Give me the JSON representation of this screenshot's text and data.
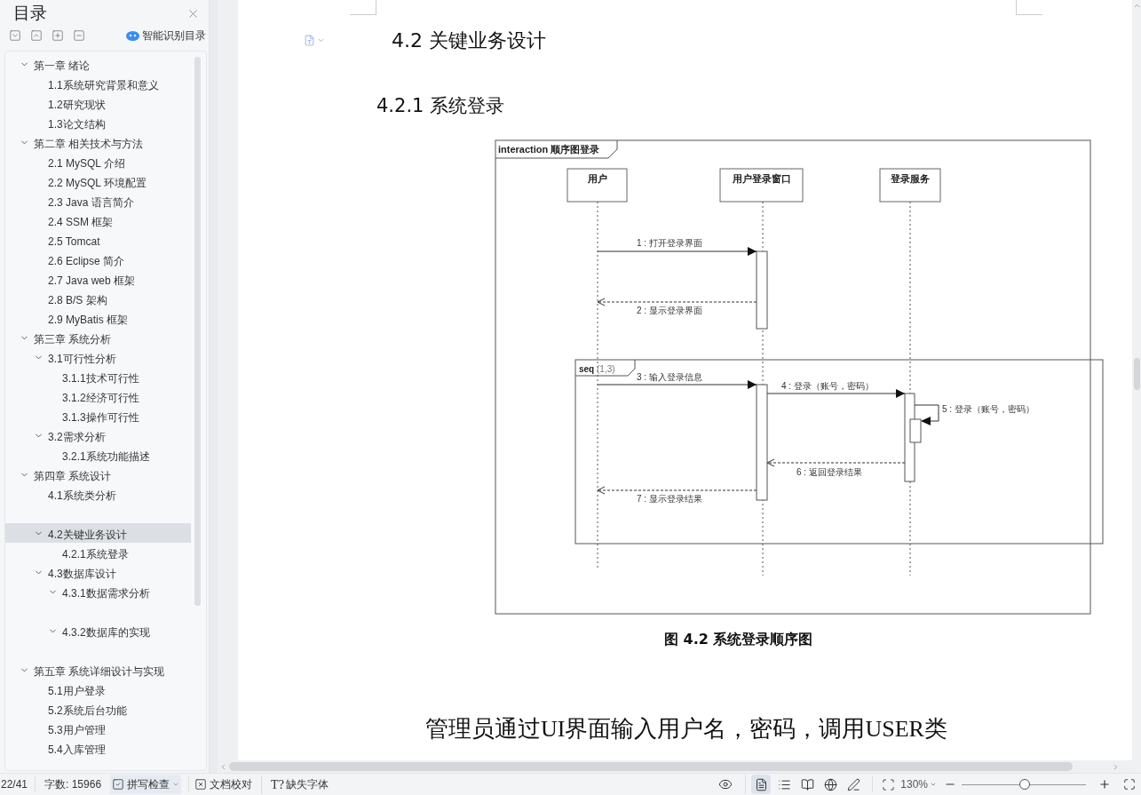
{
  "sidebar": {
    "title": "目录",
    "smart_button": "智能识别目录",
    "items": [
      {
        "label": "第一章  绪论",
        "expanded": true,
        "selected": false,
        "children": [
          {
            "label": "1.1系统研究背景和意义",
            "selected": false
          },
          {
            "label": "1.2研究现状",
            "selected": false
          },
          {
            "label": "1.3论文结构",
            "selected": false
          }
        ]
      },
      {
        "label": "第二章  相关技术与方法",
        "expanded": true,
        "selected": false,
        "children": [
          {
            "label": "2.1 MySQL  介绍",
            "selected": false
          },
          {
            "label": "2.2 MySQL 环境配置",
            "selected": false
          },
          {
            "label": "2.3 Java 语言简介",
            "selected": false
          },
          {
            "label": "2.4 SSM 框架",
            "selected": false
          },
          {
            "label": "2.5 Tomcat",
            "selected": false
          },
          {
            "label": "2.6 Eclipse 简介",
            "selected": false
          },
          {
            "label": "2.7 Java web 框架",
            "selected": false
          },
          {
            "label": "2.8 B/S 架构",
            "selected": false
          },
          {
            "label": "2.9 MyBatis 框架",
            "selected": false
          }
        ]
      },
      {
        "label": "第三章  系统分析",
        "expanded": true,
        "selected": false,
        "children": [
          {
            "label": "3.1可行性分析",
            "expanded": true,
            "selected": false,
            "children": [
              {
                "label": "3.1.1技术可行性",
                "selected": false
              },
              {
                "label": "3.1.2经济可行性",
                "selected": false
              },
              {
                "label": "3.1.3操作可行性",
                "selected": false
              }
            ]
          },
          {
            "label": "3.2需求分析",
            "expanded": true,
            "selected": false,
            "children": [
              {
                "label": "3.2.1系统功能描述",
                "selected": false
              }
            ]
          }
        ]
      },
      {
        "label": "第四章  系统设计",
        "expanded": true,
        "selected": false,
        "children": [
          {
            "label": "4.1系统类分析",
            "selected": false,
            "blank_after": true
          },
          {
            "label": "4.2关键业务设计",
            "expanded": true,
            "selected": true,
            "children": [
              {
                "label": "4.2.1系统登录",
                "selected": false
              }
            ]
          },
          {
            "label": "4.3数据库设计",
            "expanded": true,
            "selected": false,
            "children": [
              {
                "label": "4.3.1数据需求分析",
                "expanded": true,
                "selected": false,
                "blank_after": true
              },
              {
                "label": "4.3.2数据库的实现",
                "expanded": true,
                "selected": false,
                "blank_after": true
              }
            ]
          }
        ]
      },
      {
        "label": "第五章  系统详细设计与实现",
        "expanded": true,
        "selected": false,
        "children": [
          {
            "label": "5.1用户登录",
            "selected": false
          },
          {
            "label": "5.2系统后台功能",
            "selected": false
          },
          {
            "label": "5.3用户管理",
            "selected": false
          },
          {
            "label": "5.4入库管理",
            "selected": false
          }
        ]
      }
    ]
  },
  "document": {
    "heading": "4.2 关键业务设计",
    "subheading": "4.2.1  系统登录",
    "diagram": {
      "frame_label": "interaction 顺序图登录",
      "lifelines": [
        "用户",
        "用户登录窗口",
        "登录服务"
      ],
      "fragment_keyword": "seq",
      "fragment_args": "(1,3)",
      "messages": [
        {
          "label": "1 : 打开登录界面",
          "kind": "call"
        },
        {
          "label": "2 : 显示登录界面",
          "kind": "return"
        },
        {
          "label": "3 : 输入登录信息",
          "kind": "call"
        },
        {
          "label": "4 : 登录（账号，密码）",
          "kind": "call"
        },
        {
          "label": "5 : 登录（账号，密码）",
          "kind": "self"
        },
        {
          "label": "6 : 返回登录结果",
          "kind": "return"
        },
        {
          "label": "7 : 显示登录结果",
          "kind": "return"
        }
      ]
    },
    "caption": "图 4.2 系统登录顺序图",
    "body": "管理员通过UI界面输入用户名，密码，调用USER类"
  },
  "status_bar": {
    "page": "22/41",
    "word_count": "字数: 15966",
    "spell_check": {
      "label": "拼写检查",
      "on": true
    },
    "proofread": "文档校对",
    "missing_fonts_icon": "T?",
    "missing_fonts": "缺失字体",
    "view_modes": [
      {
        "kind": "page",
        "selected": true
      },
      {
        "kind": "outline",
        "selected": false
      },
      {
        "kind": "reading",
        "selected": false
      },
      {
        "kind": "web",
        "selected": false
      },
      {
        "kind": "write",
        "selected": false
      }
    ],
    "zoom": "130%",
    "zoom_slider": {
      "level": 0.51
    }
  }
}
